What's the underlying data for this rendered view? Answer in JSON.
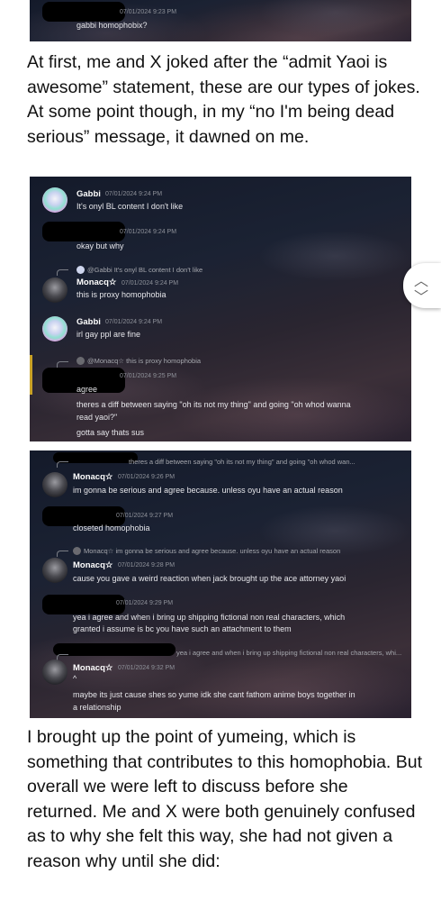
{
  "shot1": {
    "timestamp": "07/01/2024 9:23 PM",
    "message": "gabbi homophobix?"
  },
  "para1": "At first, me and X joked after the “admit Yaoi is awesome” statement, these are our types of jokes. At some point though, in my “no I'm being dead serious” message, it dawned on me.",
  "shot2": {
    "m1_name": "Gabbi",
    "m1_ts": "07/01/2024 9:24 PM",
    "m1_text": "It's onyl BL content I don't like",
    "m2_ts": "07/01/2024 9:24 PM",
    "m2_text": "okay but why",
    "m3_reply": "@Gabbi It's onyl BL content I don't like",
    "m3_name": "Monacq☆",
    "m3_ts": "07/01/2024 9:24 PM",
    "m3_text": "this is proxy homophobia",
    "m4_name": "Gabbi",
    "m4_ts": "07/01/2024 9:24 PM",
    "m4_text": "irl gay ppl are fine",
    "m5_reply": "@Monacq☆ this is proxy homophobia",
    "m5_ts": "07/01/2024 9:25 PM",
    "m5_l1": "agree",
    "m5_l2": "theres a diff between saying \"oh its not my thing\" and going \"oh whod wanna",
    "m5_l3": "read yaoi?\"",
    "m5_l4": "gotta say thats sus"
  },
  "shot3": {
    "m1_reply": "theres a diff between saying \"oh its not my thing\" and going \"oh whod wan...",
    "m1_name": "Monacq☆",
    "m1_ts": "07/01/2024 9:26 PM",
    "m1_text": "im gonna be serious and agree because. unless oyu have an actual reason",
    "m2_ts": "07/01/2024 9:27 PM",
    "m2_text": "closeted homophobia",
    "m3_reply": "Monacq☆ im gonna be serious and agree because. unless oyu have an actual reason",
    "m3_name": "Monacq☆",
    "m3_ts": "07/01/2024 9:28 PM",
    "m3_text": "cause you gave a weird reaction when jack brought up the ace attorney yaoi",
    "m4_ts": "07/01/2024 9:29 PM",
    "m4_l1": "yea i agree and when i bring up shipping fictional non real characters, which",
    "m4_l2": "granted i assume is bc you have such an attachment to them",
    "m5_reply": "yea i agree and when i bring up shipping fictional non real characters, whi...",
    "m5_name": "Monacq☆",
    "m5_ts": "07/01/2024 9:32 PM",
    "m5_l0": "^",
    "m5_l1": "maybe its just cause shes so yume idk she cant fathom anime boys together in",
    "m5_l2": "a relationship"
  },
  "para2": "I brought up the point of yumeing, which is something that contributes to this homophobia. But overall we were left to discuss before she returned. Me and X were both genuinely confused as to why she felt this way, she had not given a reason why until she did:",
  "scroll_up": "︿",
  "scroll_down": "﹀"
}
